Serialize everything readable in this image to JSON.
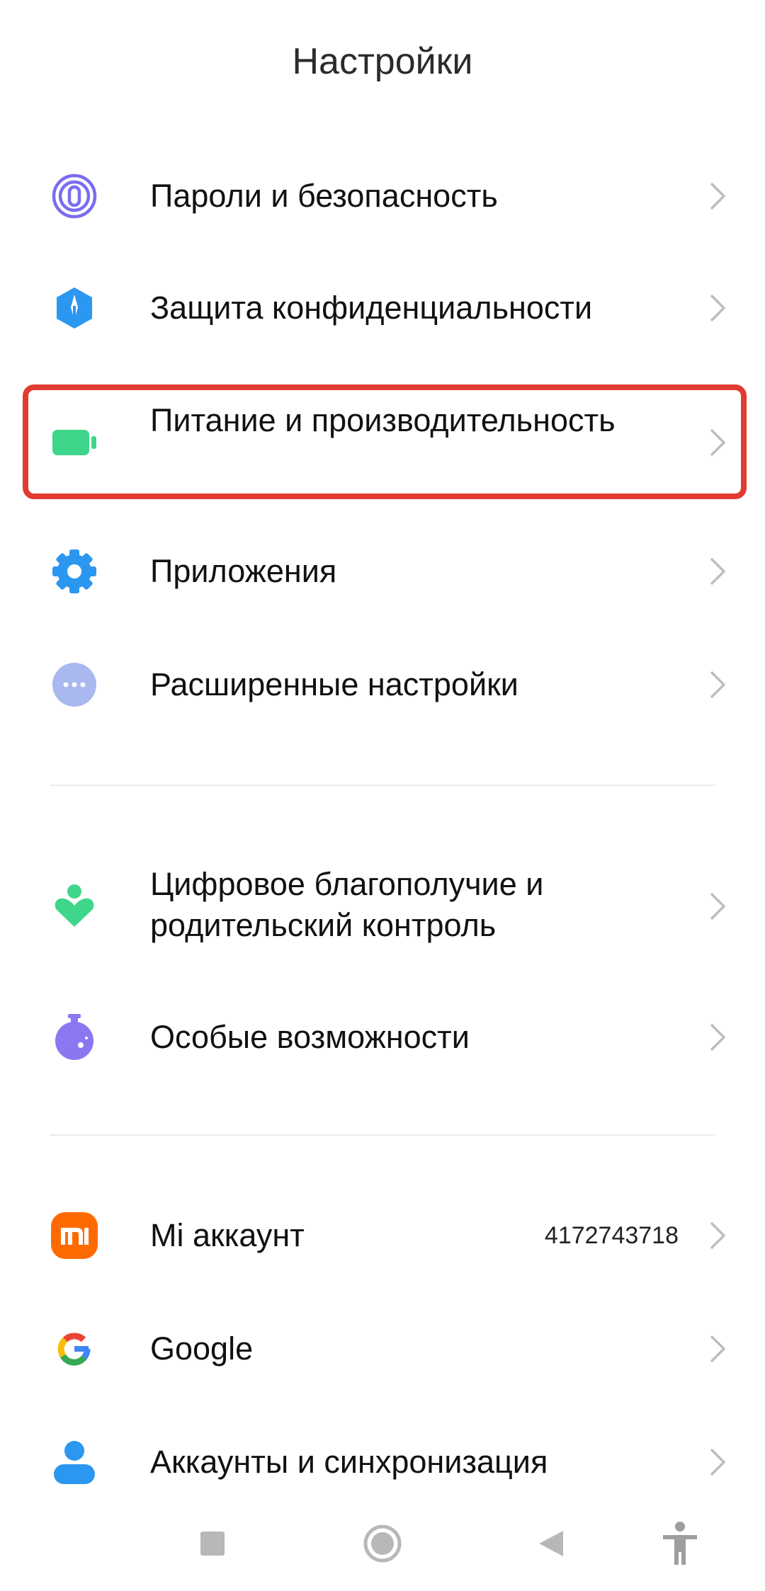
{
  "header": {
    "title": "Настройки"
  },
  "items": [
    {
      "label": "Пароли и безопасность",
      "icon": "fingerprint-icon",
      "color": "#7b6cf0"
    },
    {
      "label": "Защита конфиденциальности",
      "icon": "privacy-shield-icon",
      "color": "#2b97f0"
    },
    {
      "label": "Питание и производительность",
      "icon": "battery-icon",
      "color": "#3ed68a",
      "highlighted": true
    },
    {
      "label": "Приложения",
      "icon": "gear-icon",
      "color": "#2b97f0"
    },
    {
      "label": "Расширенные настройки",
      "icon": "more-dots-icon",
      "color": "#a9b8ee"
    },
    {
      "label": "Цифровое благополучие и родительский контроль",
      "icon": "wellbeing-icon",
      "color": "#3ed68a"
    },
    {
      "label": "Особые возможности",
      "icon": "accessibility-flask-icon",
      "color": "#8a78f2"
    },
    {
      "label": "Mi аккаунт",
      "value": "4172743718",
      "icon": "mi-logo-icon",
      "color": "#ff6a00"
    },
    {
      "label": "Google",
      "icon": "google-logo-icon"
    },
    {
      "label": "Аккаунты и синхронизация",
      "icon": "person-icon",
      "color": "#2b97f0"
    }
  ],
  "navbar": {
    "buttons": [
      "recents-square-icon",
      "home-circle-icon",
      "back-triangle-icon",
      "accessibility-person-icon"
    ]
  },
  "colors": {
    "highlight_border": "#e23b30",
    "chevron": "#bdbdbd",
    "divider": "#ececec"
  }
}
